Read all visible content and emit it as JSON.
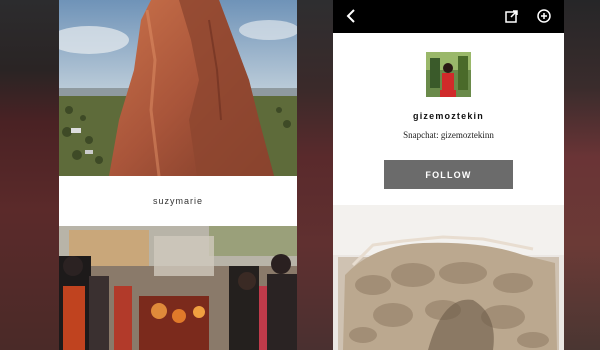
{
  "left_feed": {
    "post_caption_user": "suzymarie"
  },
  "profile": {
    "username": "gizemoztekin",
    "bio": "Snapchat: gizemoztekinn",
    "follow_label": "FOLLOW"
  },
  "topbar": {
    "icons": [
      "back-chevron-icon",
      "share-icon",
      "add-circle-icon"
    ]
  },
  "colors": {
    "topbar_bg": "#000000",
    "follow_button_bg": "#6b6b6b"
  }
}
